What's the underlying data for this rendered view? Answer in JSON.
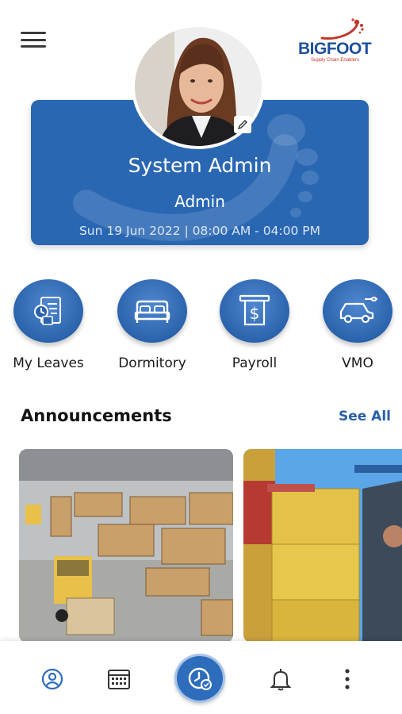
{
  "header": {
    "menu_icon": "hamburger-menu-icon",
    "brand": {
      "name": "BIGFOOT",
      "tagline": "Supply Chain Enablers",
      "color": "#1d4f9c",
      "accent": "#c0392b"
    }
  },
  "profile": {
    "name": "System Admin",
    "role": "Admin",
    "shift": "Sun 19 Jun 2022 | 08:00 AM - 04:00 PM",
    "card_color": "#2a67b3",
    "edit_icon": "pencil-icon"
  },
  "quick_actions": [
    {
      "label": "My Leaves",
      "icon": "leave-calendar-icon"
    },
    {
      "label": "Dormitory",
      "icon": "bed-icon"
    },
    {
      "label": "Payroll",
      "icon": "dollar-document-icon"
    },
    {
      "label": "VMO",
      "icon": "car-service-icon"
    }
  ],
  "announcements": {
    "title": "Announcements",
    "see_all": "See All"
  },
  "bottom_nav": {
    "items": [
      "profile-icon",
      "calendar-icon",
      "attendance-clock-icon",
      "bell-icon",
      "more-vertical-icon"
    ],
    "active": "attendance-clock-icon",
    "accent": "#2e6cbc"
  }
}
